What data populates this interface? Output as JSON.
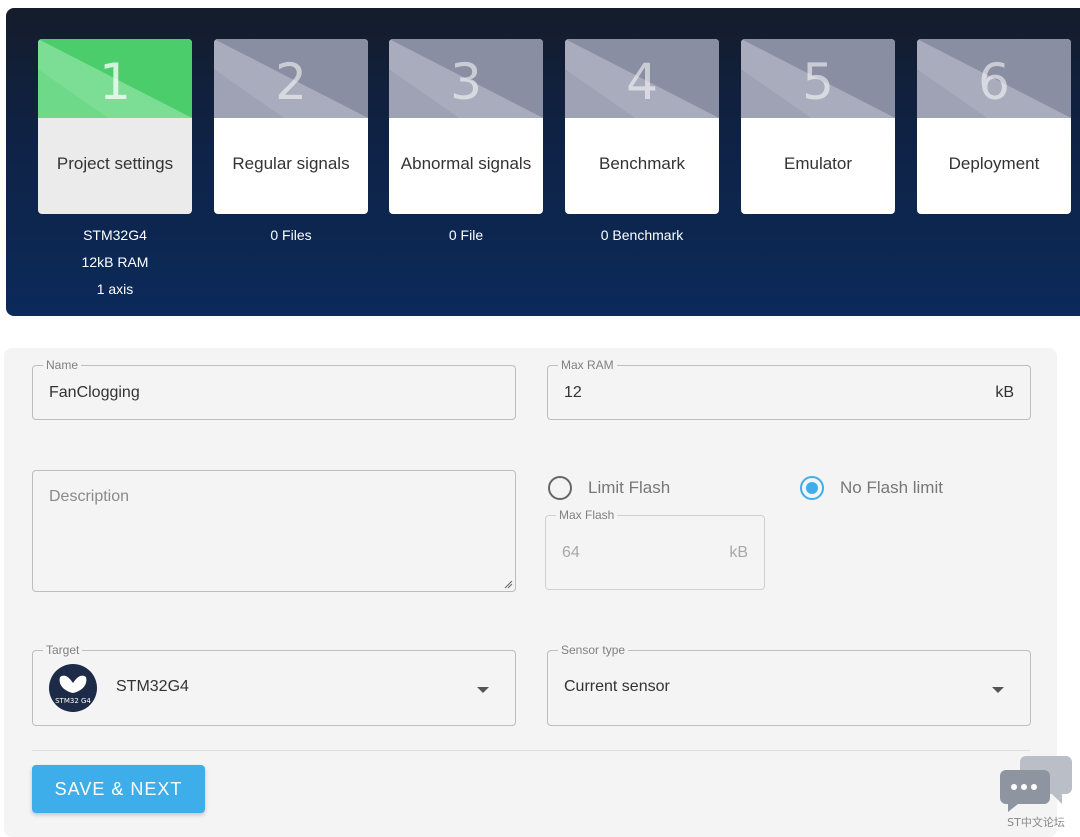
{
  "steps": [
    {
      "number": "1",
      "label": "Project settings",
      "info": [
        "STM32G4",
        "12kB RAM",
        "1 axis"
      ],
      "active": true
    },
    {
      "number": "2",
      "label": "Regular signals",
      "info": [
        "0 Files"
      ],
      "active": false
    },
    {
      "number": "3",
      "label": "Abnormal signals",
      "info": [
        "0 File"
      ],
      "active": false
    },
    {
      "number": "4",
      "label": "Benchmark",
      "info": [
        "0 Benchmark"
      ],
      "active": false
    },
    {
      "number": "5",
      "label": "Emulator",
      "info": [],
      "active": false
    },
    {
      "number": "6",
      "label": "Deployment",
      "info": [],
      "active": false
    }
  ],
  "form": {
    "name": {
      "legend": "Name",
      "value": "FanClogging"
    },
    "max_ram": {
      "legend": "Max RAM",
      "value": "12",
      "unit": "kB"
    },
    "description": {
      "placeholder": "Description"
    },
    "flash": {
      "limit_label": "Limit Flash",
      "no_limit_label": "No Flash limit",
      "selected": "no_limit"
    },
    "max_flash": {
      "legend": "Max Flash",
      "value": "64",
      "unit": "kB"
    },
    "target": {
      "legend": "Target",
      "value": "STM32G4",
      "logo_text": "STM32 G4"
    },
    "sensor_type": {
      "legend": "Sensor type",
      "value": "Current sensor"
    }
  },
  "actions": {
    "save_label": "SAVE & NEXT"
  },
  "chat_widget": {
    "caption": "ST中文论坛"
  },
  "colors": {
    "accent": "#3daee9",
    "active_step": "#6fd98a",
    "inactive_step": "#9fa2b4",
    "stepper_bg": "#0b2a5a"
  }
}
